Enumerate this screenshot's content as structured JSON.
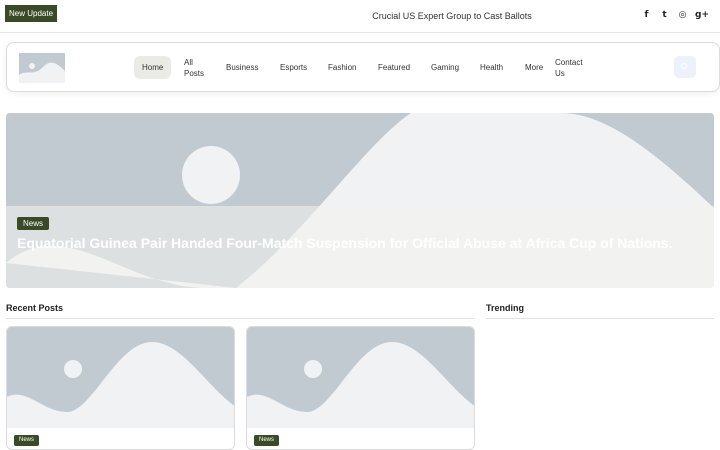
{
  "topbar": {
    "badge": "New Update",
    "ticker": "Crucial US Expert Group to Cast Ballots",
    "social_icons": [
      "facebook-icon",
      "twitter-icon",
      "instagram-icon",
      "google-plus-icon"
    ],
    "social_glyphs": [
      "f",
      "t",
      "◎",
      "g+"
    ]
  },
  "nav": {
    "items": [
      {
        "label": "Home",
        "active": true
      },
      {
        "label": "All Posts"
      },
      {
        "label": "Business"
      },
      {
        "label": "Esports"
      },
      {
        "label": "Fashion"
      },
      {
        "label": "Featured"
      },
      {
        "label": "Gaming"
      },
      {
        "label": "Health"
      },
      {
        "label": "More"
      },
      {
        "label": "Contact Us"
      }
    ]
  },
  "hero": {
    "tag": "News",
    "title": "Equatorial Guinea Pair Handed Four-Match Suspension for Official Abuse at Africa Cup of Nations."
  },
  "sections": {
    "recent": "Recent Posts",
    "trending": "Trending"
  },
  "recent_posts": [
    {
      "tag": "News"
    },
    {
      "tag": "News"
    }
  ],
  "colors": {
    "accent": "#3b4a26",
    "placeholder": "#c2cad1",
    "placeholder_light": "#f1f2f3"
  }
}
